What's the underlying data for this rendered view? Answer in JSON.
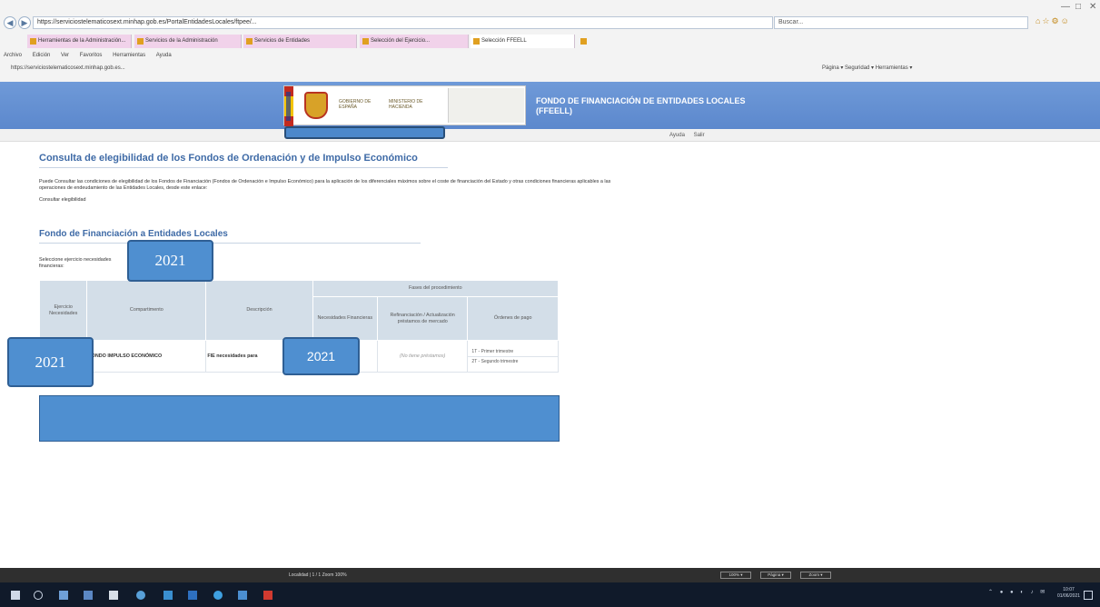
{
  "browser": {
    "address": "https://serviciostelematicosext.minhap.gob.es/PortalEntidadesLocales/ftpee/...",
    "search_placeholder": "Buscar...",
    "tabs": [
      "Herramientas de la Administración...",
      "Servicios de la Administración",
      "Servicios de Entidades",
      "Selección del Ejercicio...",
      "Selección FFEELL"
    ],
    "menu": [
      "Archivo",
      "Edición",
      "Ver",
      "Favoritos",
      "Herramientas",
      "Ayuda"
    ],
    "favorites": "https://serviciostelematicosext.minhap.gob.es...",
    "commands": "Página ▾   Seguridad ▾   Herramientas ▾"
  },
  "site": {
    "title": "FONDO DE FINANCIACIÓN DE ENTIDADES LOCALES (FFEELL)",
    "gov_line1": "GOBIERNO DE ESPAÑA",
    "gov_line2": "MINISTERIO DE HACIENDA",
    "help": "Ayuda",
    "logout": "Salir"
  },
  "content": {
    "main_title": "Consulta de elegibilidad de los Fondos de Ordenación y de Impulso Económico",
    "intro": "Puede Consultar las condiciones de elegibilidad de los Fondos de Financiación (Fondos de Ordenación e Impulso Económico) para la aplicación de los diferenciales máximos sobre el coste de financiación del Estado y otras condiciones financieras aplicables a las operaciones de endeudamiento de las Entidades Locales, desde este enlace:",
    "intro_link": "Consultar elegibilidad",
    "section_title": "Fondo de Financiación a Entidades Locales",
    "select_label": "Seleccione ejercicio necesidades financieras:"
  },
  "callouts": {
    "year_select": "2021",
    "year_row": "2021",
    "year_desc": "2021"
  },
  "table": {
    "group_header": "Fases del procedimiento",
    "headers": {
      "year": "Ejercicio Necesidades",
      "compartment": "Compartimento",
      "description": "Descripción",
      "needs": "Necesidades Financieras",
      "refinancing": "Refinanciación / Actualización préstamos de mercado",
      "payment_orders": "Órdenes de pago"
    },
    "row": {
      "compartment": "FONDO IMPULSO ECONÓMICO",
      "description": "FIE necesidades para",
      "refinancing": "(No tiene préstamos)",
      "payment_orders": [
        "1T - Primer trimestre",
        "2T - Segundo trimestre"
      ]
    }
  },
  "status_bar": {
    "text": "Localidad  |  1 / 1 Zoom 100%",
    "buttons": [
      "100% ▾",
      "Página ▾",
      "Zoom ▾"
    ]
  },
  "taskbar": {
    "time": "10:07",
    "date": "01/06/2021"
  }
}
